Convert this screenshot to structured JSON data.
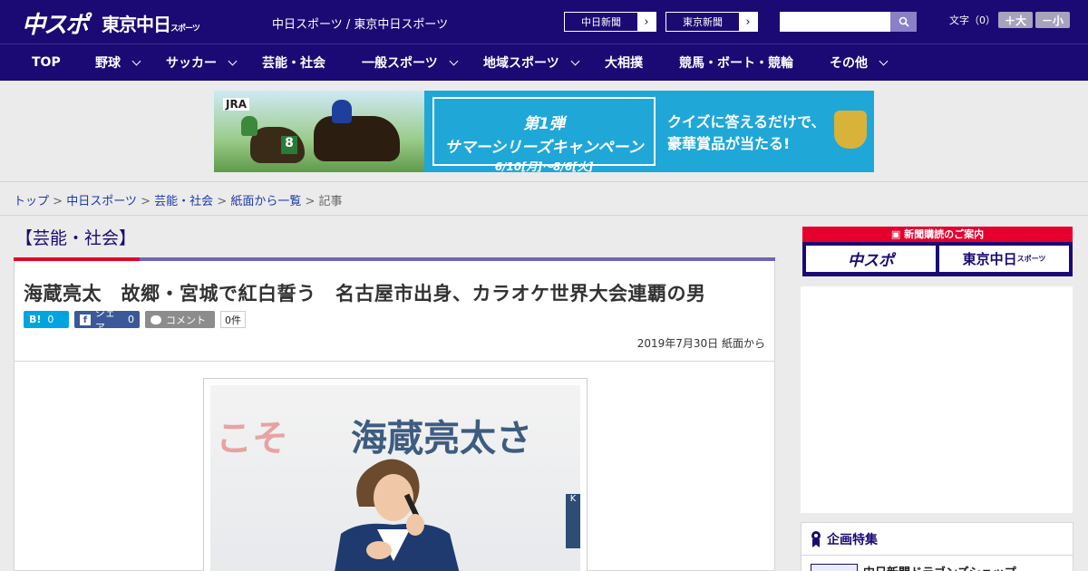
{
  "header": {
    "logo_chuspo": "中スポ",
    "logo_tokyo": "東京中日",
    "logo_tokyo_small": "スポーツ",
    "site_name": "中日スポーツ / 東京中日スポーツ",
    "paper_buttons": [
      "中日新聞",
      "東京新聞"
    ],
    "search_placeholder": "",
    "font_label": "文字（0）",
    "font_plus": "＋大",
    "font_minus": "－小"
  },
  "nav": {
    "items": [
      {
        "label": "TOP",
        "dropdown": false
      },
      {
        "label": "野球",
        "dropdown": true
      },
      {
        "label": "サッカー",
        "dropdown": true
      },
      {
        "label": "芸能・社会",
        "dropdown": false
      },
      {
        "label": "一般スポーツ",
        "dropdown": true
      },
      {
        "label": "地域スポーツ",
        "dropdown": true
      },
      {
        "label": "大相撲",
        "dropdown": false
      },
      {
        "label": "競馬・ボート・競輪",
        "dropdown": false
      },
      {
        "label": "その他",
        "dropdown": true
      }
    ]
  },
  "banner": {
    "jra": "JRA",
    "horse_number": "8",
    "title_line1": "第1弾",
    "title_line2": "サマーシリーズキャンペーン",
    "title_line3": "6/10[月]～8/6[火]",
    "quiz_line1": "クイズに答えるだけで、",
    "quiz_line2": "豪華賞品が当たる!"
  },
  "breadcrumb": {
    "items": [
      "トップ",
      "中日スポーツ",
      "芸能・社会",
      "紙面から一覧"
    ],
    "current": "記事",
    "separator": ">"
  },
  "article": {
    "category": "【芸能・社会】",
    "title": "海蔵亮太　故郷・宮城で紅白誓う　名古屋市出身、カラオケ世界大会連覇の男",
    "hatena_label": "B!",
    "hatena_count": "0",
    "facebook_label": "シェア",
    "facebook_count": "0",
    "comment_label": "コメント",
    "comment_count": "0件",
    "date": "2019年7月30日 紙面から",
    "photo_sign_left": "こそ",
    "photo_sign_right": "海蔵亮太さ",
    "photo_sign_small": "K"
  },
  "sidebar": {
    "subscription_header": "新聞購読のご案内",
    "sub_btn1": "中スポ",
    "sub_btn2": "東京中日",
    "sub_btn2_small": "スポーツ",
    "feature_title": "企画特集",
    "feature_item": "中日新聞ドラゴンズショップ"
  },
  "colors": {
    "header_bg": "#1b0a73",
    "accent_red": "#e6002d",
    "category_line": "#6f64b7",
    "hatena": "#00a4de",
    "facebook": "#3b5998",
    "comment": "#8c8c8c"
  }
}
